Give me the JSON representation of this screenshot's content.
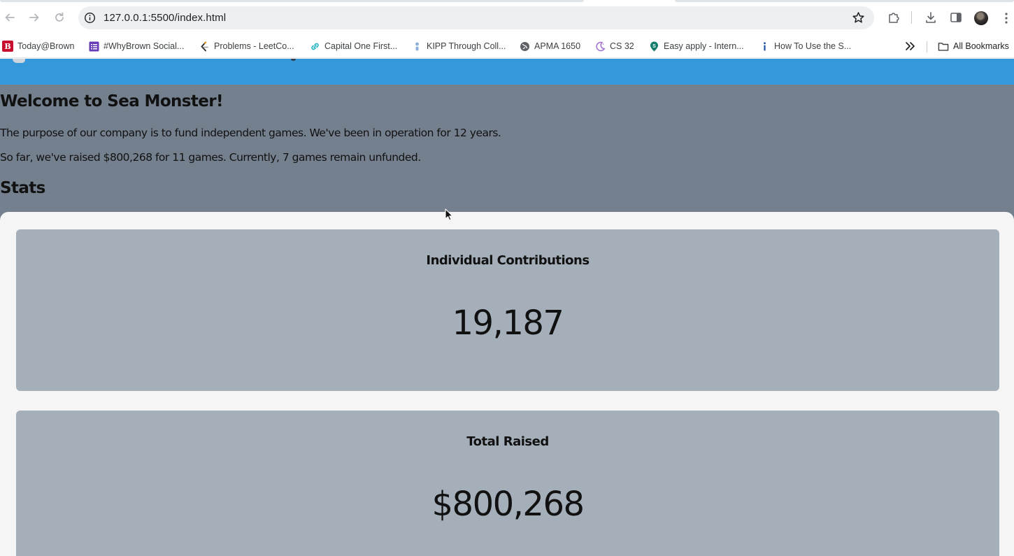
{
  "browser": {
    "url": "127.0.0.1:5500/index.html",
    "bookmarks": [
      {
        "label": "Today@Brown",
        "icon": "brown-b-icon",
        "color": "#c8102e"
      },
      {
        "label": "#WhyBrown Social...",
        "icon": "form-icon",
        "color": "#673ab7"
      },
      {
        "label": "Problems - LeetCo...",
        "icon": "leetcode-icon",
        "color": "#f89f1b"
      },
      {
        "label": "Capital One First...",
        "icon": "link-icon",
        "color": "#29b6c6"
      },
      {
        "label": "KIPP Through Coll...",
        "icon": "person-icon",
        "color": "#8fb0d9"
      },
      {
        "label": "APMA 1650",
        "icon": "globe-icon",
        "color": "#5f6368"
      },
      {
        "label": "CS 32",
        "icon": "moon-icon",
        "color": "#a070d0"
      },
      {
        "label": "Easy apply - Intern...",
        "icon": "map-pin-icon",
        "color": "#127c6b"
      },
      {
        "label": "How To Use the S...",
        "icon": "info-icon",
        "color": "#1a4fa0"
      }
    ],
    "all_bookmarks_label": "All Bookmarks"
  },
  "page": {
    "welcome_title": "Welcome to Sea Monster!",
    "intro_line": "The purpose of our company is to fund independent games. We've been in operation for 12 years.",
    "summary_line": "So far, we've raised $800,268 for 11 games. Currently, 7 games remain unfunded.",
    "stats_title": "Stats",
    "stats": [
      {
        "label": "Individual Contributions",
        "value": "19,187"
      },
      {
        "label": "Total Raised",
        "value": "$800,268"
      }
    ]
  },
  "colors": {
    "header_blue": "#3498db",
    "page_background": "#75808f",
    "card_background": "#a5afb9",
    "stats_container": "#f5f5f5"
  }
}
